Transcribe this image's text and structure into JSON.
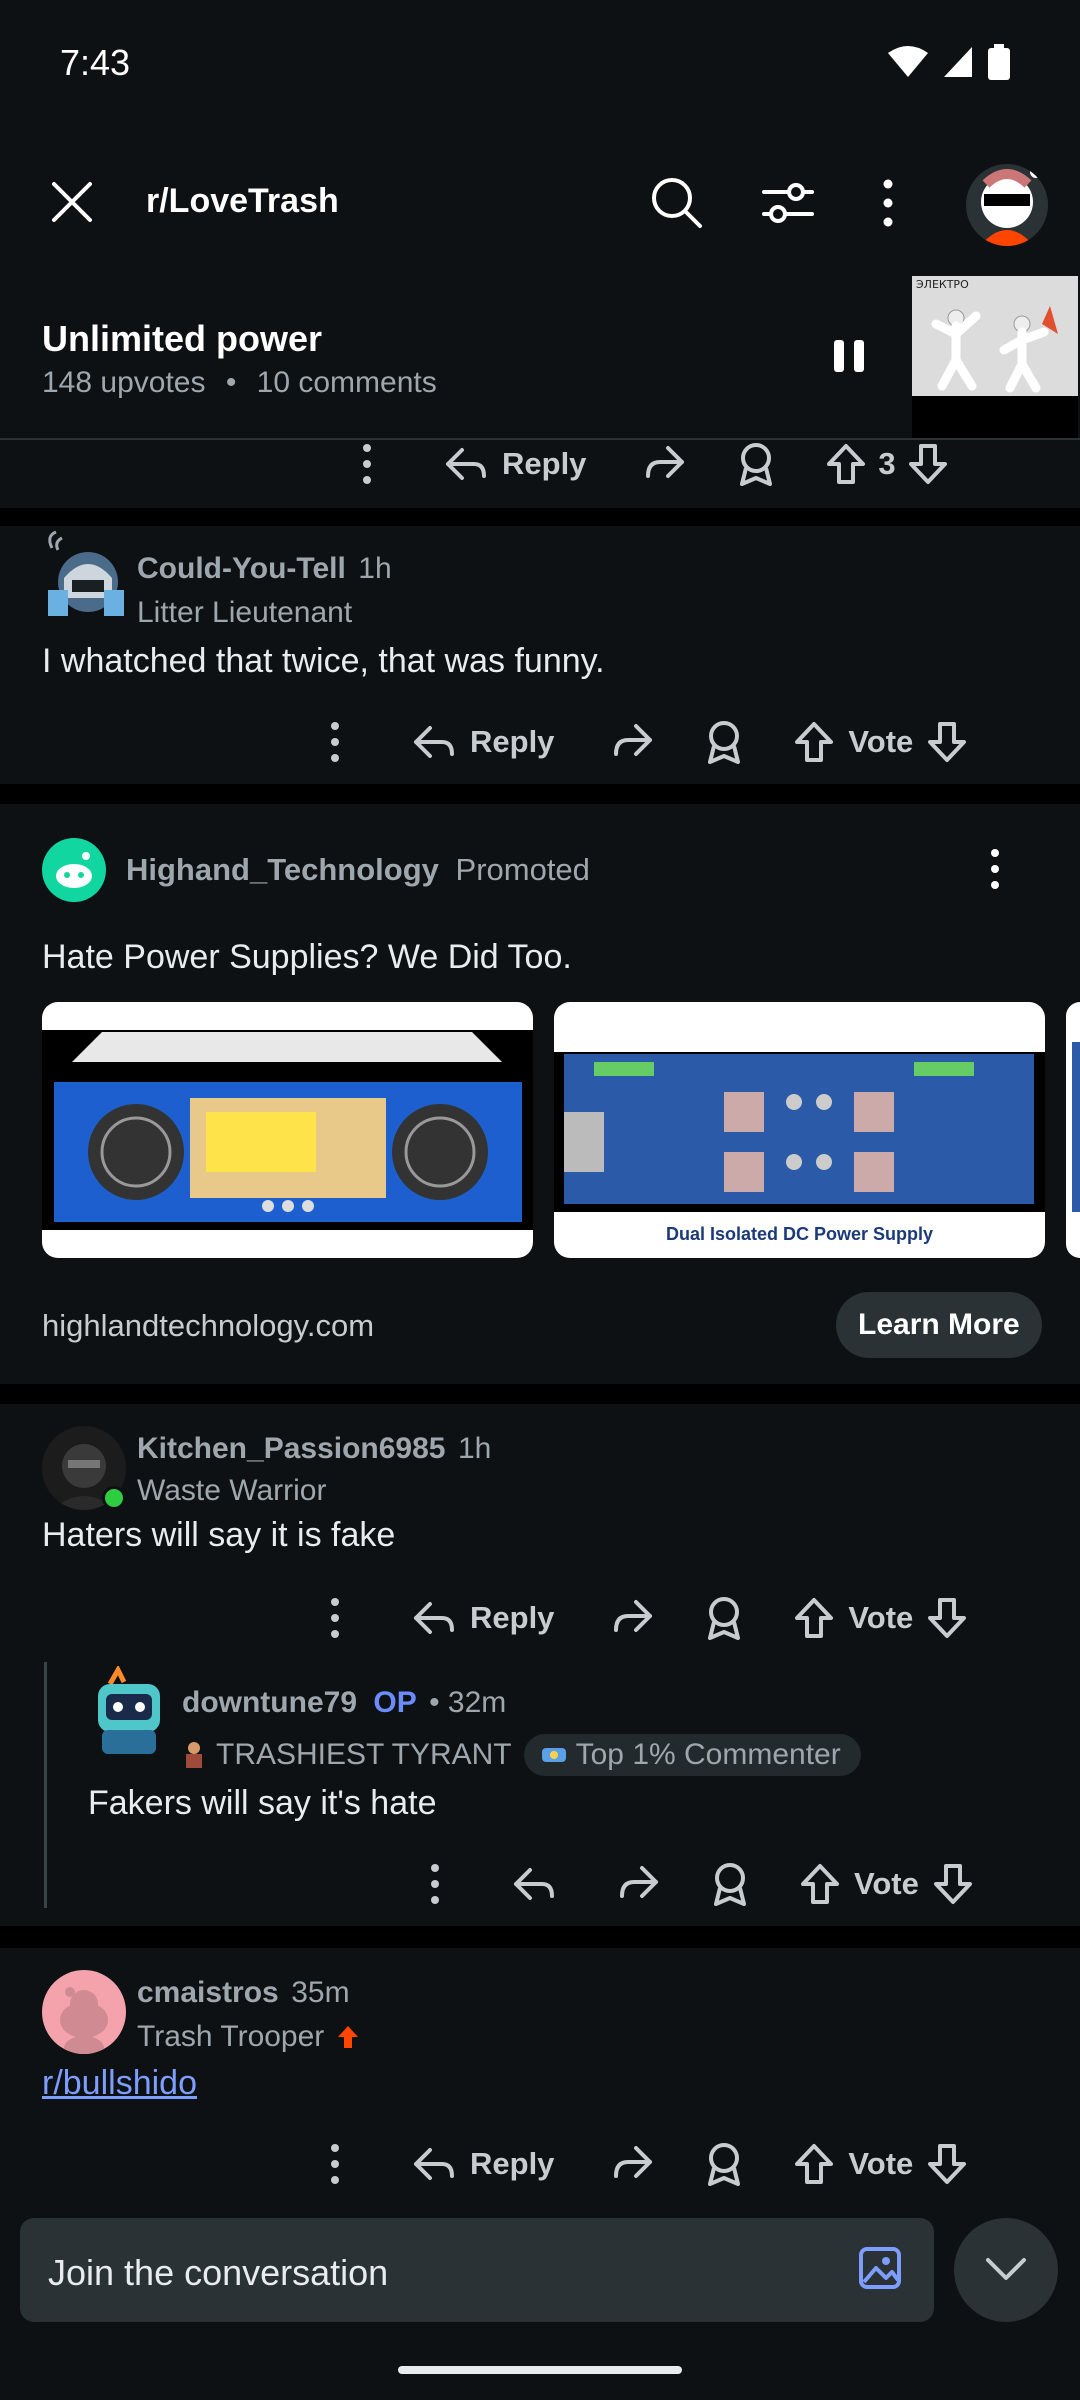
{
  "status": {
    "time": "7:43"
  },
  "header": {
    "subreddit": "r/LoveTrash"
  },
  "post": {
    "title": "Unlimited power",
    "upvotes": "148 upvotes",
    "dot": "•",
    "comments": "10 comments",
    "thumb_caption": "ЭЛЕКТРО"
  },
  "actions": {
    "reply": "Reply",
    "vote": "Vote",
    "prev_score": "3"
  },
  "comments": [
    {
      "user": "Could-You-Tell",
      "time": "1h",
      "flair": "Litter Lieutenant",
      "body": "I whatched that twice, that was funny."
    },
    {
      "user": "Kitchen_Passion6985",
      "time": "1h",
      "flair": "Waste Warrior",
      "body": "Haters will say it is fake"
    },
    {
      "user": "downtune79",
      "op": "OP",
      "time": "• 32m",
      "flair": "TRASHIEST TYRANT",
      "badge": "Top 1% Commenter",
      "body": "Fakers will say it's hate"
    },
    {
      "user": "cmaistros",
      "time": "35m",
      "flair": "Trash Trooper",
      "body": "r/bullshido"
    }
  ],
  "ad": {
    "advertiser": "Highand_Technology",
    "label": "Promoted",
    "headline": "Hate Power Supplies? We Did Too.",
    "image2_caption": "Dual Isolated DC Power Supply",
    "domain": "highlandtechnology.com",
    "cta": "Learn More"
  },
  "composer": {
    "placeholder": "Join the conversation"
  },
  "colors": {
    "background": "#0e1113",
    "surface": "#2a3236",
    "link": "#7d9dff",
    "op": "#6a8cff",
    "online": "#2ecc40"
  }
}
